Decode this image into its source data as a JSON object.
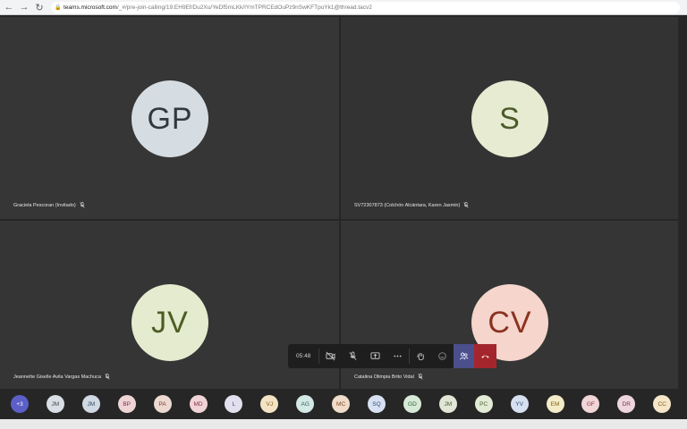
{
  "browser": {
    "url_host": "teams.microsoft.com",
    "url_path": "/_#/pre-join-calling/19:EH9Ef/Du2Xu/YeDf5mLKk/IYmTPRCEdOuPz9nSwKFTpuYk1@thread.tacv2"
  },
  "tiles": [
    {
      "initials": "GP",
      "name": "Graciela Pescoran (Invitado)",
      "avatar_bg": "#d6dde2",
      "avatar_fg": "#2f3a40"
    },
    {
      "initials": "S",
      "name": "SV72307873 (Colchón Alcántara, Karen Jasmin)",
      "avatar_bg": "#e6ebd2",
      "avatar_fg": "#4c5a2a"
    },
    {
      "initials": "JV",
      "name": "Jeannette Giselle Avila Vargas Machuca",
      "avatar_bg": "#e4ebcf",
      "avatar_fg": "#4d5d22"
    },
    {
      "initials": "CV",
      "name": "Catalina Olimpia Brito Vidal",
      "avatar_bg": "#f5d5cc",
      "avatar_fg": "#8a3220"
    }
  ],
  "controls": {
    "timer": "05:48"
  },
  "participants": [
    {
      "initials": "+3",
      "bg": "#5b5fc7",
      "fg": "#ffffff"
    },
    {
      "initials": "JM",
      "bg": "#d9dfe4",
      "fg": "#37474f"
    },
    {
      "initials": "JM",
      "bg": "#cfd8e3",
      "fg": "#324a5f"
    },
    {
      "initials": "BP",
      "bg": "#eed4d7",
      "fg": "#7d3340"
    },
    {
      "initials": "PA",
      "bg": "#ecd9d0",
      "fg": "#7a4330"
    },
    {
      "initials": "MD",
      "bg": "#f0d3d6",
      "fg": "#8a3140"
    },
    {
      "initials": "L",
      "bg": "#e2e0ef",
      "fg": "#4a4580"
    },
    {
      "initials": "VJ",
      "bg": "#f3e3c5",
      "fg": "#805b14"
    },
    {
      "initials": "AG",
      "bg": "#d4e8e6",
      "fg": "#2e6560"
    },
    {
      "initials": "MC",
      "bg": "#f0dcc9",
      "fg": "#7c4a22"
    },
    {
      "initials": "SQ",
      "bg": "#d7e1f2",
      "fg": "#2f4b80"
    },
    {
      "initials": "GD",
      "bg": "#d7ead8",
      "fg": "#2f6133"
    },
    {
      "initials": "JM",
      "bg": "#e1e6d6",
      "fg": "#4d5a30"
    },
    {
      "initials": "PC",
      "bg": "#e1ebd6",
      "fg": "#4b6230"
    },
    {
      "initials": "YV",
      "bg": "#d6e0f0",
      "fg": "#334d78"
    },
    {
      "initials": "EM",
      "bg": "#f4ebc8",
      "fg": "#7a6418"
    },
    {
      "initials": "GF",
      "bg": "#f2d5d8",
      "fg": "#8c3442"
    },
    {
      "initials": "DR",
      "bg": "#eed6dd",
      "fg": "#7b3550"
    },
    {
      "initials": "CC",
      "bg": "#f5e6c8",
      "fg": "#7e5c18"
    }
  ]
}
